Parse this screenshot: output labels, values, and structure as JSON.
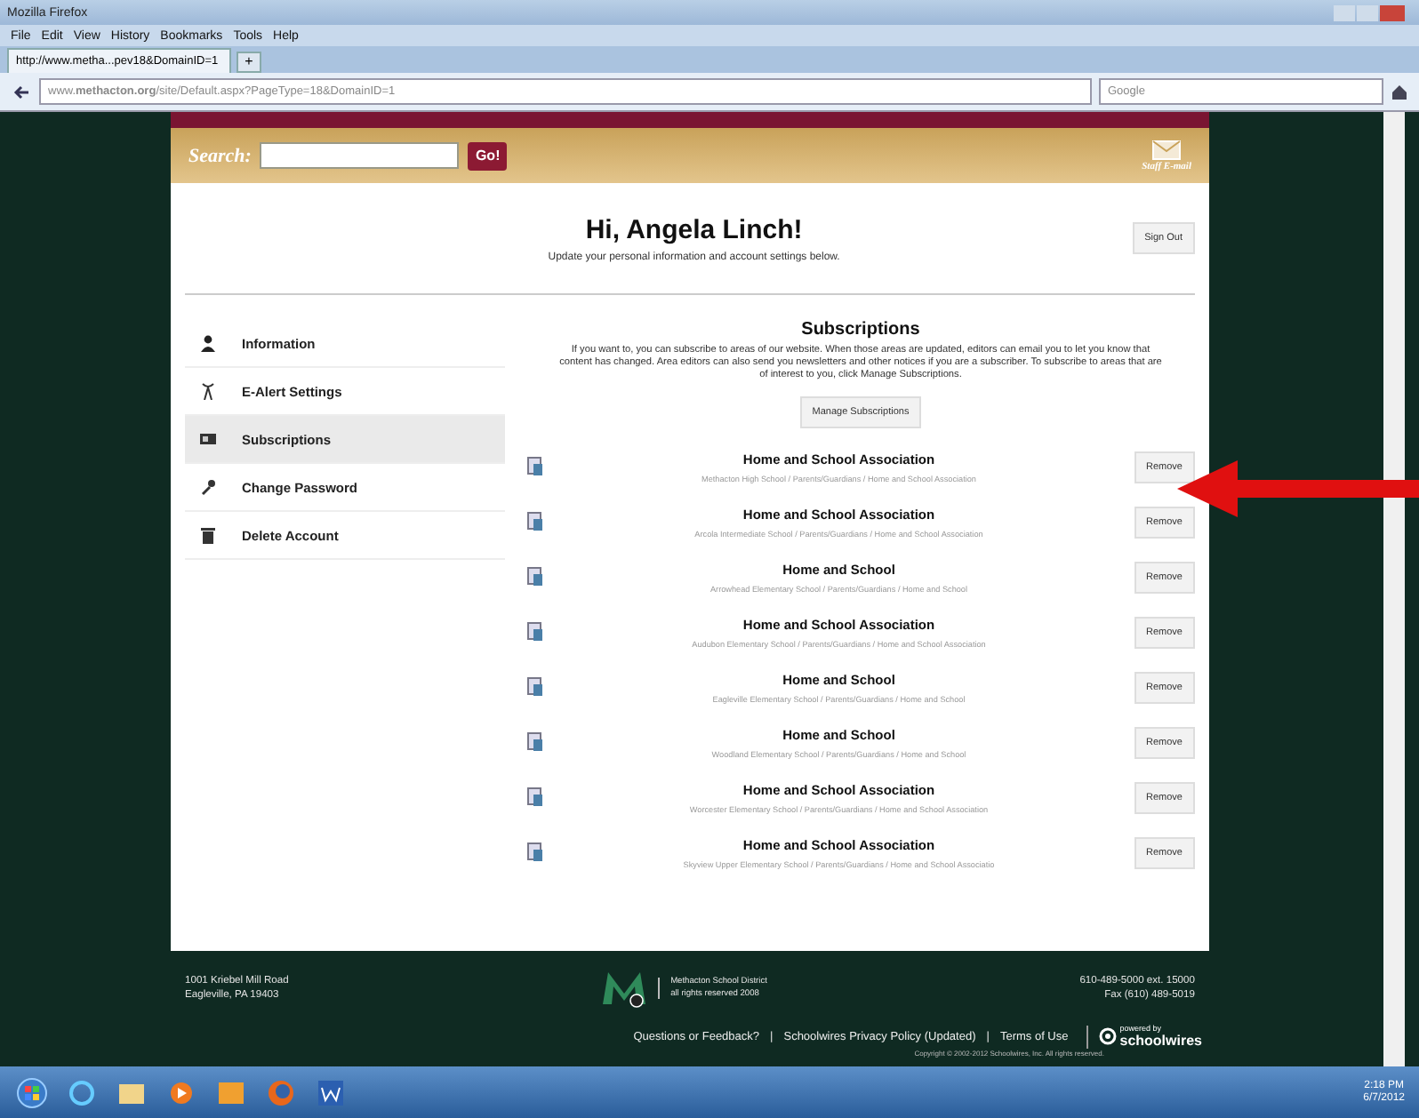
{
  "window": {
    "title": "Mozilla Firefox"
  },
  "menu": [
    "File",
    "Edit",
    "View",
    "History",
    "Bookmarks",
    "Tools",
    "Help"
  ],
  "tab": {
    "label": "http://www.metha...pev18&DomainID=1",
    "new_tab": "+"
  },
  "address_bar": {
    "url": "www.**methacton.org**/site/Default.aspx?PageType=18&DomainID=1"
  },
  "search_bar": {
    "placeholder": "Google"
  },
  "site_header": {
    "search_label": "Search:",
    "go_button": "Go!",
    "staff_email": "Staff E-mail"
  },
  "greeting": {
    "title": "Hi, Angela Linch!",
    "subtitle": "Update your personal information and account settings below.",
    "sign_out": "Sign Out"
  },
  "sidebar": {
    "items": [
      {
        "label": "Information",
        "selected": false
      },
      {
        "label": "E-Alert Settings",
        "selected": false
      },
      {
        "label": "Subscriptions",
        "selected": true
      },
      {
        "label": "Change Password",
        "selected": false
      },
      {
        "label": "Delete Account",
        "selected": false
      }
    ]
  },
  "subscriptions": {
    "title": "Subscriptions",
    "description": "If you want to, you can subscribe to areas of our website. When those areas are updated, editors can email you to let you know that content has changed. Area editors can also send you newsletters and other notices if you are a subscriber. To subscribe to areas that are of interest to you, click Manage Subscriptions.",
    "manage_button": "Manage Subscriptions",
    "items": [
      {
        "title": "Home and School Association",
        "path": "Methacton High School / Parents/Guardians / Home and School Association",
        "remove": "Remove"
      },
      {
        "title": "Home and School Association",
        "path": "Arcola Intermediate School / Parents/Guardians / Home and School Association",
        "remove": "Remove"
      },
      {
        "title": "Home and School",
        "path": "Arrowhead Elementary School / Parents/Guardians / Home and School",
        "remove": "Remove"
      },
      {
        "title": "Home and School Association",
        "path": "Audubon Elementary School / Parents/Guardians / Home and School Association",
        "remove": "Remove"
      },
      {
        "title": "Home and School",
        "path": "Eagleville Elementary School / Parents/Guardians / Home and School",
        "remove": "Remove"
      },
      {
        "title": "Home and School",
        "path": "Woodland Elementary School / Parents/Guardians / Home and School",
        "remove": "Remove"
      },
      {
        "title": "Home and School Association",
        "path": "Worcester Elementary School / Parents/Guardians / Home and School Association",
        "remove": "Remove"
      },
      {
        "title": "Home and School Association",
        "path": "Skyview Upper Elementary School / Parents/Guardians / Home and School Associatio",
        "remove": "Remove"
      }
    ]
  },
  "footer": {
    "address": [
      "1001 Kriebel Mill Road",
      "Eagleville, PA 19403"
    ],
    "district": [
      "Methacton School District",
      "all rights reserved 2008"
    ],
    "phone": [
      "610-489-5000 ext. 15000",
      "Fax (610) 489-5019"
    ],
    "links": [
      "Questions or Feedback?",
      "Schoolwires Privacy Policy (Updated)",
      "Terms of Use"
    ],
    "separator": "|",
    "copyright": "Copyright © 2002-2012 Schoolwires, Inc. All rights reserved.",
    "powered_by": "powered by",
    "brand": "schoolwires"
  },
  "taskbar": {
    "time": "2:18 PM",
    "date": "6/7/2012"
  }
}
